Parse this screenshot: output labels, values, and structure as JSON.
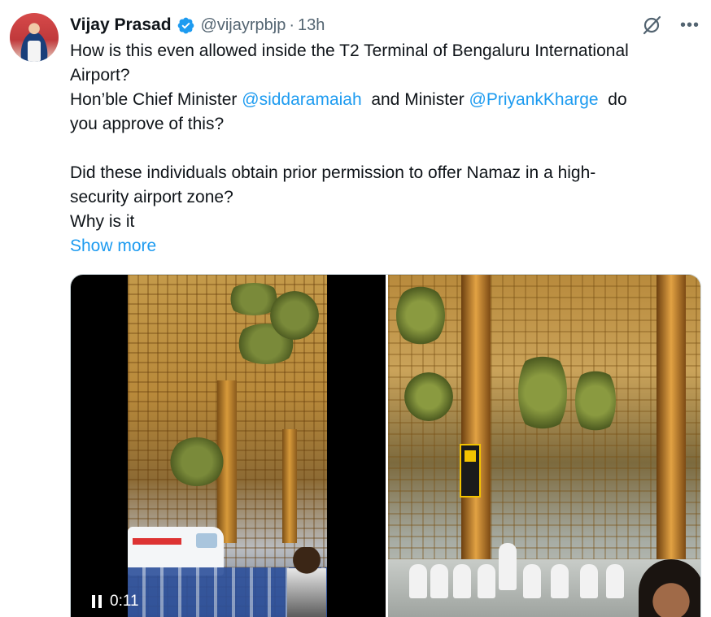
{
  "tweet": {
    "author": {
      "display_name": "Vijay Prasad",
      "handle": "@vijayrpbjp",
      "separator": "·",
      "time": "13h"
    },
    "text_lines": {
      "l1": "How is this even allowed inside the T2 Terminal of Bengaluru International",
      "l2": "Airport?",
      "l3_pre": "Hon’ble Chief Minister ",
      "l3_mention1": "@siddaramaiah",
      "l3_mid": "  and Minister ",
      "l3_mention2": "@PriyankKharge",
      "l3_post": "  do",
      "l4": "you approve of this?",
      "l5": "Did these individuals obtain prior permission to offer Namaz in a high-",
      "l6": "security airport zone?",
      "l7": "Why is it"
    },
    "show_more": "Show more",
    "video": {
      "time": "0:11"
    },
    "icons": {
      "verified": "verified-badge-icon",
      "grok": "grok-icon",
      "more": "more-icon",
      "pause": "pause-icon"
    },
    "colors": {
      "accent": "#1d9bf0",
      "text": "#0f1419",
      "muted": "#536471"
    }
  }
}
